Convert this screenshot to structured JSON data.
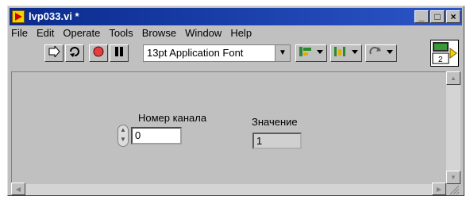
{
  "window": {
    "title": "lvp033.vi *",
    "buttons": {
      "minimize": "_",
      "maximize": "□",
      "close": "×"
    }
  },
  "menu": [
    "File",
    "Edit",
    "Operate",
    "Tools",
    "Browse",
    "Window",
    "Help"
  ],
  "toolbar": {
    "font_select": "13pt Application Font",
    "icons": [
      "run-arrow-icon",
      "run-continuous-icon",
      "abort-stop-icon",
      "pause-icon",
      "align-objects-icon",
      "distribute-objects-icon",
      "reorder-icon"
    ]
  },
  "connector_pane": {
    "number": "2"
  },
  "panel": {
    "control": {
      "label": "Номер канала",
      "value": "0"
    },
    "indicator": {
      "label": "Значение",
      "value": "1"
    }
  }
}
